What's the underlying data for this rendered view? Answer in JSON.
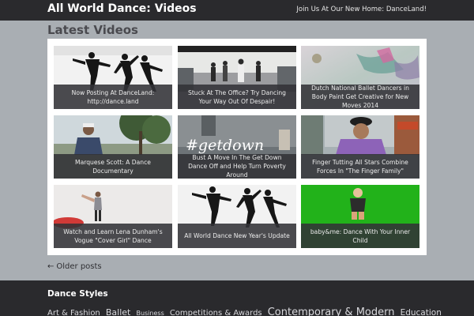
{
  "header": {
    "site_title": "All World Dance: Videos",
    "top_link": "Join Us At Our New Home: DanceLand!"
  },
  "main": {
    "section_title": "Latest Videos",
    "videos": [
      {
        "title": "Now Posting At DanceLand: http://dance.land"
      },
      {
        "title": "Stuck At The Office? Try Dancing Your Way Out Of Despair!"
      },
      {
        "title": "Dutch National Ballet Dancers in Body Paint Get Creative for New Moves 2014"
      },
      {
        "title": "Marquese Scott: A Dance Documentary"
      },
      {
        "title": "Bust A Move In The Get Down Dance Off and Help Turn Poverty Around"
      },
      {
        "title": "Finger Tutting All Stars Combine Forces In \"The Finger Family\""
      },
      {
        "title": "Watch and Learn Lena Dunham's Vogue \"Cover Girl\" Dance"
      },
      {
        "title": "All World Dance New Year's Update"
      },
      {
        "title": "baby&me: Dance With Your Inner Child"
      }
    ],
    "thumb_text": "#getdown",
    "older_posts": {
      "arrow": "←",
      "label": "Older posts"
    }
  },
  "footer": {
    "title": "Dance Styles",
    "tags": [
      "Art & Fashion",
      "Ballet",
      "Business",
      "Competitions & Awards",
      "Contemporary & Modern",
      "Education"
    ]
  },
  "colors": {
    "background": "#a9aeb3",
    "bar": "#2a2a2d",
    "caption": "#323237",
    "green_screen": "#22b21a"
  }
}
